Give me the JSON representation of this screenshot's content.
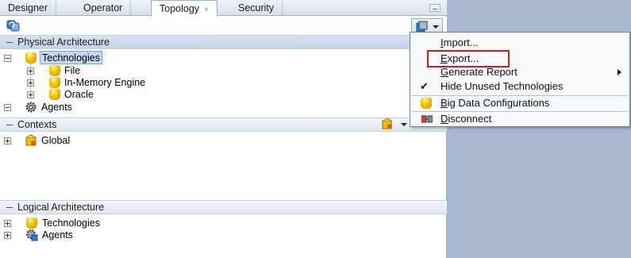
{
  "tabs": [
    {
      "label": "Designer",
      "active": false
    },
    {
      "label": "Operator",
      "active": false
    },
    {
      "label": "Topology",
      "active": true
    },
    {
      "label": "Security",
      "active": false
    }
  ],
  "physical": {
    "header": "Physical Architecture",
    "technologies_label": "Technologies",
    "tech_children": [
      "File",
      "In-Memory Engine",
      "Oracle"
    ],
    "agents_label": "Agents"
  },
  "contexts": {
    "header": "Contexts",
    "global_label": "Global"
  },
  "logical": {
    "header": "Logical Architecture",
    "technologies_label": "Technologies",
    "agents_label": "Agents"
  },
  "menu": {
    "items": [
      {
        "label": "Import...",
        "mnemonic": "I"
      },
      {
        "label": "Export...",
        "mnemonic": "E",
        "highlighted": true
      },
      {
        "label": "Generate Report",
        "mnemonic": "G",
        "submenu": true
      },
      {
        "label": "Hide Unused Technologies",
        "checked": true
      },
      {
        "label": "Big Data Configurations",
        "mnemonic": "B",
        "icon": "cylinder-icon"
      },
      {
        "label": "Disconnect",
        "mnemonic": "D",
        "icon": "disconnect-icon"
      }
    ]
  },
  "colors": {
    "highlight_border": "#d11a1a",
    "selection_bg": "#c6d7ef",
    "background": "#a8b9d0"
  }
}
